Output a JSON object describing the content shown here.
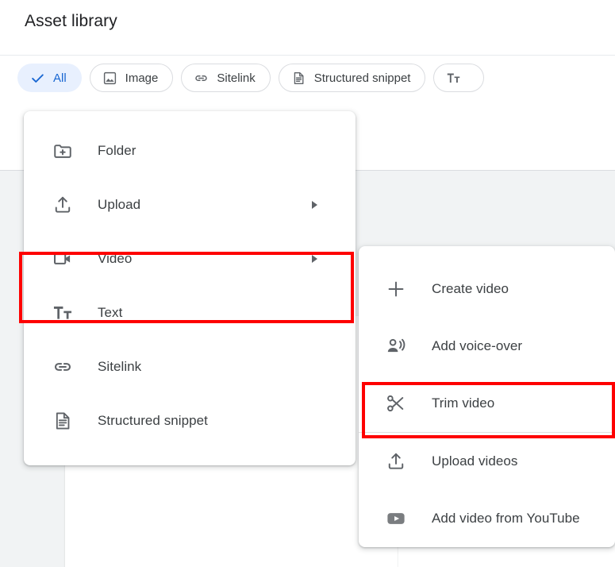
{
  "page": {
    "title": "Asset library"
  },
  "filter_chips": [
    {
      "label": "All",
      "icon": "check-icon",
      "selected": true
    },
    {
      "label": "Image",
      "icon": "image-icon",
      "selected": false
    },
    {
      "label": "Sitelink",
      "icon": "link-icon",
      "selected": false
    },
    {
      "label": "Structured snippet",
      "icon": "document-icon",
      "selected": false
    },
    {
      "label": "",
      "icon": "text-format-icon",
      "selected": false
    }
  ],
  "primary_menu": {
    "items": [
      {
        "label": "Folder",
        "icon": "create-new-folder-icon",
        "has_submenu": false
      },
      {
        "label": "Upload",
        "icon": "upload-icon",
        "has_submenu": true
      },
      {
        "label": "Video",
        "icon": "videocam-icon",
        "has_submenu": true,
        "highlighted": true
      },
      {
        "label": "Text",
        "icon": "text-format-icon",
        "has_submenu": false
      },
      {
        "label": "Sitelink",
        "icon": "link-icon",
        "has_submenu": false
      },
      {
        "label": "Structured snippet",
        "icon": "document-icon",
        "has_submenu": false
      }
    ]
  },
  "video_submenu": {
    "items": [
      {
        "label": "Create video",
        "icon": "plus-icon",
        "has_separator_after": false
      },
      {
        "label": "Add voice-over",
        "icon": "voice-over-icon",
        "has_separator_after": false
      },
      {
        "label": "Trim video",
        "icon": "scissors-icon",
        "has_separator_after": true,
        "highlighted": true
      },
      {
        "label": "Upload videos",
        "icon": "upload-icon",
        "has_separator_after": false
      },
      {
        "label": "Add video from YouTube",
        "icon": "youtube-icon",
        "has_separator_after": false
      }
    ]
  },
  "annotations": [
    {
      "name": "video-highlight",
      "target": "Video",
      "color": "#fe0000"
    },
    {
      "name": "trim-video-highlight",
      "target": "Trim video",
      "color": "#fe0000"
    }
  ],
  "colors": {
    "accent": "#1967d2",
    "chip_selected_bg": "#e8f0fe",
    "icon_gray": "#5f6368",
    "text": "#3c4043",
    "annotation_red": "#fe0000",
    "surface_gray": "#f1f3f4"
  }
}
